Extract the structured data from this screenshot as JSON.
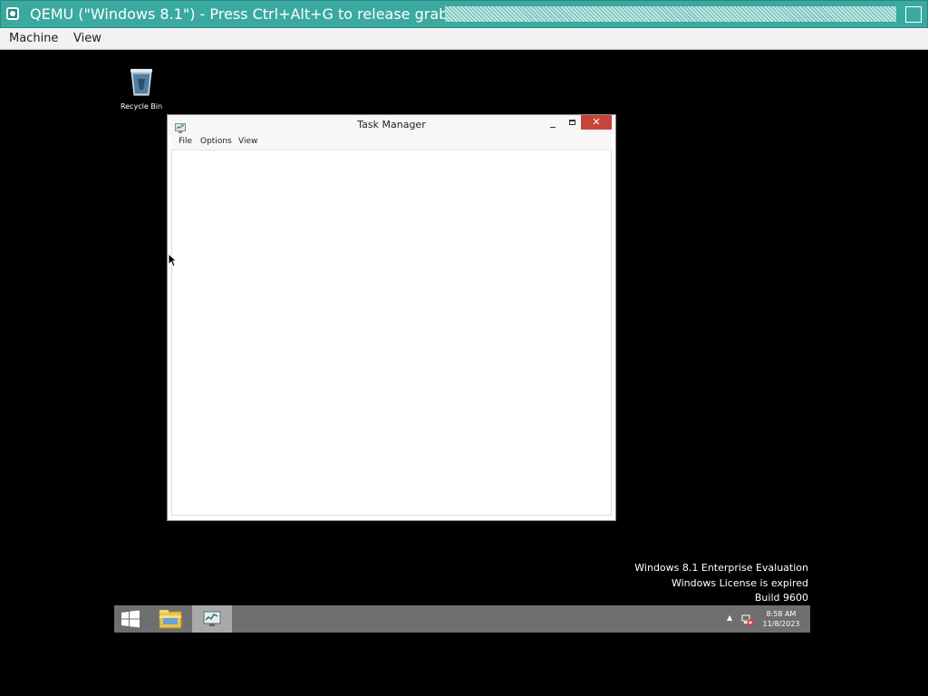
{
  "qemu": {
    "title": "QEMU (\"Windows 8.1\") - Press Ctrl+Alt+G to release grab",
    "menu": [
      "Machine",
      "View"
    ]
  },
  "desktop": {
    "icons": [
      {
        "label": "Recycle Bin",
        "icon": "recycle-bin-icon"
      }
    ]
  },
  "task_manager": {
    "title": "Task Manager",
    "menu": [
      "File",
      "Options",
      "View"
    ],
    "close_glyph": "✕"
  },
  "watermark": {
    "line1": "Windows 8.1 Enterprise Evaluation",
    "line2": "Windows License is expired",
    "line3": "Build 9600"
  },
  "taskbar": {
    "items": [
      {
        "name": "start",
        "icon": "windows-logo-icon"
      },
      {
        "name": "file-explorer",
        "icon": "folder-icon"
      },
      {
        "name": "task-manager",
        "icon": "task-manager-icon",
        "active": true
      }
    ],
    "tray": {
      "arrow": "▲",
      "network_icon": "network-error-icon"
    },
    "clock": {
      "time": "8:58 AM",
      "date": "11/8/2023"
    }
  },
  "colors": {
    "qemu_titlebar": "#3aa9a0",
    "close_button": "#c7443a",
    "taskbar": "#6f6f6f",
    "desktop": "#000000"
  }
}
